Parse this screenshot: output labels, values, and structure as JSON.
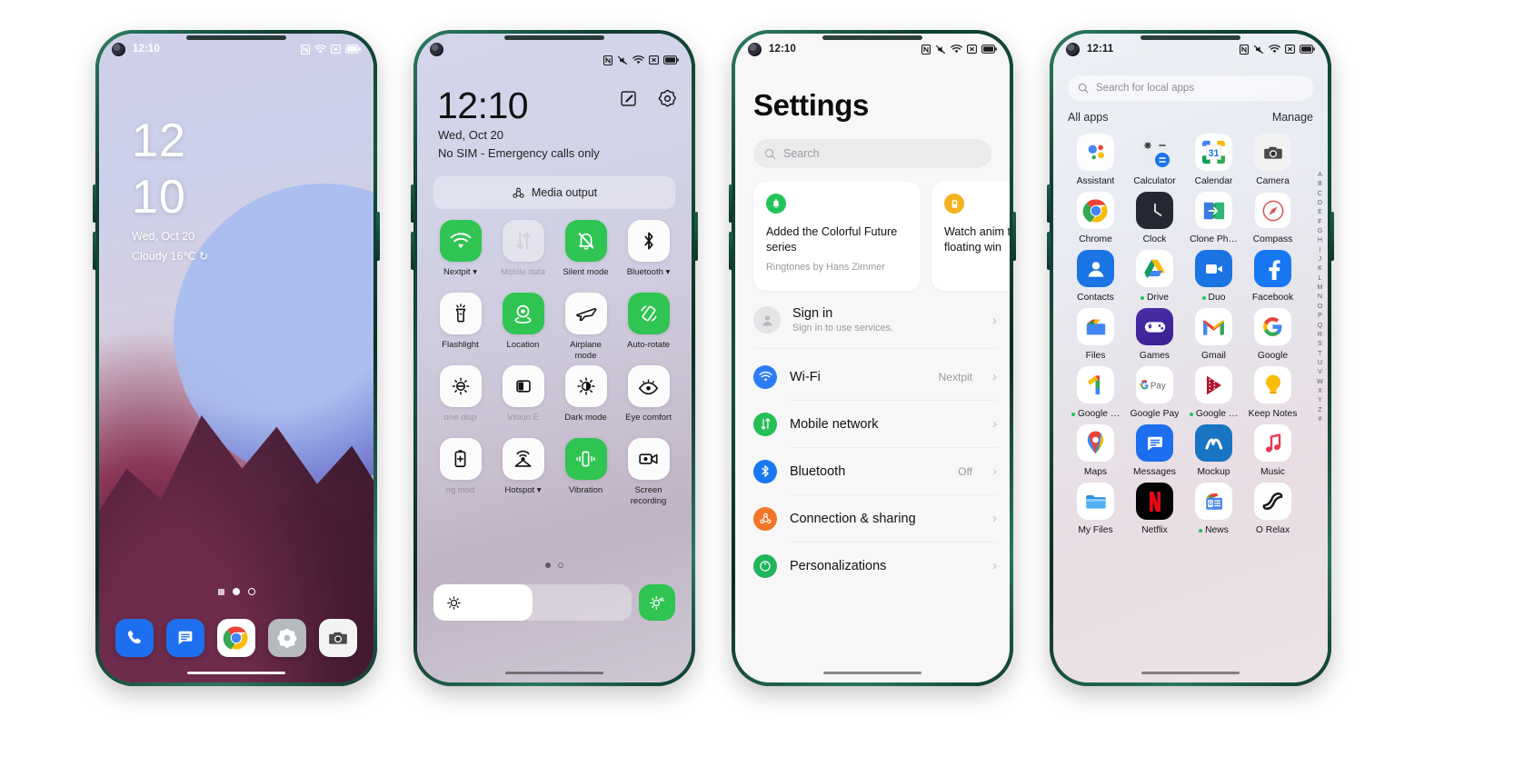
{
  "phone1": {
    "name": "lock-screen",
    "statusbar": {
      "time": "12:10",
      "icons": [
        "nfc-icon",
        "wifi-icon",
        "mute-icon",
        "battery-icon"
      ]
    },
    "clock_hours": "12",
    "clock_minutes": "10",
    "date": "Wed, Oct 20",
    "weather": "Cloudy  16℃  ↻",
    "dock": [
      {
        "name": "phone-app",
        "label": "Phone"
      },
      {
        "name": "messages-app",
        "label": "Messages"
      },
      {
        "name": "chrome-app",
        "label": "Chrome"
      },
      {
        "name": "settings-app",
        "label": "Settings"
      },
      {
        "name": "camera-app",
        "label": "Camera"
      }
    ]
  },
  "phone2": {
    "name": "quick-settings",
    "statusbar": {
      "icons": [
        "nfc-icon",
        "mute-icon",
        "wifi-icon",
        "signal-icon",
        "battery-icon"
      ]
    },
    "clock": "12:10",
    "date": "Wed, Oct 20",
    "sim": "No SIM - Emergency calls only",
    "media_output": "Media output",
    "tiles": [
      {
        "label": "Nextpit ▾",
        "state": "on",
        "icon": "wifi-icon"
      },
      {
        "label": "Mobile data",
        "state": "dim",
        "icon": "mobile-data-icon",
        "faint": true
      },
      {
        "label": "Silent mode",
        "state": "on",
        "icon": "bell-off-icon"
      },
      {
        "label": "Bluetooth ▾",
        "state": "off",
        "icon": "bluetooth-icon"
      },
      {
        "label": "Flashlight",
        "state": "off",
        "icon": "flashlight-icon"
      },
      {
        "label": "Location",
        "state": "on",
        "icon": "location-icon"
      },
      {
        "label": "Airplane mode",
        "state": "off",
        "icon": "airplane-icon"
      },
      {
        "label": "Auto-rotate",
        "state": "on",
        "icon": "auto-rotate-icon"
      },
      {
        "label": "one disp",
        "state": "off",
        "icon": "screen-tone-icon",
        "faint": true
      },
      {
        "label": "Vision E",
        "state": "off",
        "icon": "vision-enhance-icon",
        "faint": true
      },
      {
        "label": "Dark mode",
        "state": "off",
        "icon": "dark-mode-icon"
      },
      {
        "label": "Eye comfort",
        "state": "off",
        "icon": "eye-comfort-icon"
      },
      {
        "label": "ng mod",
        "state": "off",
        "icon": "battery-save-icon",
        "faint": true
      },
      {
        "label": "Hotspot ▾",
        "state": "off",
        "icon": "hotspot-icon"
      },
      {
        "label": "Vibration",
        "state": "on",
        "icon": "vibration-icon"
      },
      {
        "label": "Screen recording",
        "state": "off",
        "icon": "screen-record-icon"
      }
    ],
    "page_dots": 2,
    "brightness_percent": 50
  },
  "phone3": {
    "name": "settings-screen",
    "statusbar": {
      "time": "12:10",
      "icons": [
        "nfc-icon",
        "mute-icon",
        "wifi-icon",
        "signal-icon",
        "battery-icon"
      ]
    },
    "title": "Settings",
    "search_placeholder": "Search",
    "cards": [
      {
        "icon": "bell-icon",
        "color": "#21c45a",
        "title": "Added the Colorful Future series",
        "subtitle": "Ringtones by Hans Zimmer"
      },
      {
        "icon": "floating-window-icon",
        "color": "#f5b120",
        "title": "Watch anim to learn hov floating win",
        "subtitle": ""
      }
    ],
    "account": {
      "title": "Sign in",
      "subtitle": "Sign in to use services."
    },
    "rows": [
      {
        "label": "Wi-Fi",
        "value": "Nextpit",
        "icon": "wifi-icon",
        "color": "#2b7df5"
      },
      {
        "label": "Mobile network",
        "value": "",
        "icon": "mobile-data-icon",
        "color": "#24bf55"
      },
      {
        "label": "Bluetooth",
        "value": "Off",
        "icon": "bluetooth-icon",
        "color": "#1878f0"
      },
      {
        "label": "Connection & sharing",
        "value": "",
        "icon": "connection-sharing-icon",
        "color": "#f2762a"
      },
      {
        "label": "Personalizations",
        "value": "",
        "icon": "personalization-icon",
        "color": "#1fb55c"
      }
    ]
  },
  "phone4": {
    "name": "app-drawer",
    "statusbar": {
      "time": "12:11",
      "icons": [
        "nfc-icon",
        "mute-icon",
        "wifi-icon",
        "signal-icon",
        "battery-icon"
      ]
    },
    "search_placeholder": "Search for local apps",
    "header_left": "All apps",
    "header_right": "Manage",
    "alphabet": [
      "A",
      "B",
      "C",
      "D",
      "E",
      "F",
      "G",
      "H",
      "I",
      "J",
      "K",
      "L",
      "M",
      "N",
      "O",
      "P",
      "Q",
      "R",
      "S",
      "T",
      "U",
      "V",
      "W",
      "X",
      "Y",
      "Z",
      "#"
    ],
    "apps": [
      {
        "name": "Assistant",
        "icon": "google-assistant-icon",
        "badge": false
      },
      {
        "name": "Calculator",
        "icon": "calculator-icon",
        "badge": false
      },
      {
        "name": "Calendar",
        "icon": "google-calendar-icon",
        "badge": false
      },
      {
        "name": "Camera",
        "icon": "camera-icon",
        "badge": false
      },
      {
        "name": "Chrome",
        "icon": "chrome-icon",
        "badge": false
      },
      {
        "name": "Clock",
        "icon": "clock-icon",
        "badge": false
      },
      {
        "name": "Clone Ph…",
        "icon": "clone-phone-icon",
        "badge": false
      },
      {
        "name": "Compass",
        "icon": "compass-icon",
        "badge": false
      },
      {
        "name": "Contacts",
        "icon": "contacts-icon",
        "badge": false
      },
      {
        "name": "Drive",
        "icon": "google-drive-icon",
        "badge": true
      },
      {
        "name": "Duo",
        "icon": "google-duo-icon",
        "badge": true
      },
      {
        "name": "Facebook",
        "icon": "facebook-icon",
        "badge": false
      },
      {
        "name": "Files",
        "icon": "files-icon",
        "badge": false
      },
      {
        "name": "Games",
        "icon": "games-icon",
        "badge": false
      },
      {
        "name": "Gmail",
        "icon": "gmail-icon",
        "badge": false
      },
      {
        "name": "Google",
        "icon": "google-icon",
        "badge": false
      },
      {
        "name": "Google …",
        "icon": "google-one-icon",
        "badge": true
      },
      {
        "name": "Google Pay",
        "icon": "google-pay-icon",
        "badge": false
      },
      {
        "name": "Google …",
        "icon": "google-play-movies-icon",
        "badge": true
      },
      {
        "name": "Keep Notes",
        "icon": "google-keep-icon",
        "badge": false
      },
      {
        "name": "Maps",
        "icon": "google-maps-icon",
        "badge": false
      },
      {
        "name": "Messages",
        "icon": "messages-icon",
        "badge": false
      },
      {
        "name": "Mockup",
        "icon": "mockup-icon",
        "badge": false
      },
      {
        "name": "Music",
        "icon": "music-icon",
        "badge": false
      },
      {
        "name": "My Files",
        "icon": "my-files-icon",
        "badge": false
      },
      {
        "name": "Netflix",
        "icon": "netflix-icon",
        "badge": false
      },
      {
        "name": "News",
        "icon": "google-news-icon",
        "badge": true
      },
      {
        "name": "O Relax",
        "icon": "o-relax-icon",
        "badge": false
      }
    ]
  }
}
